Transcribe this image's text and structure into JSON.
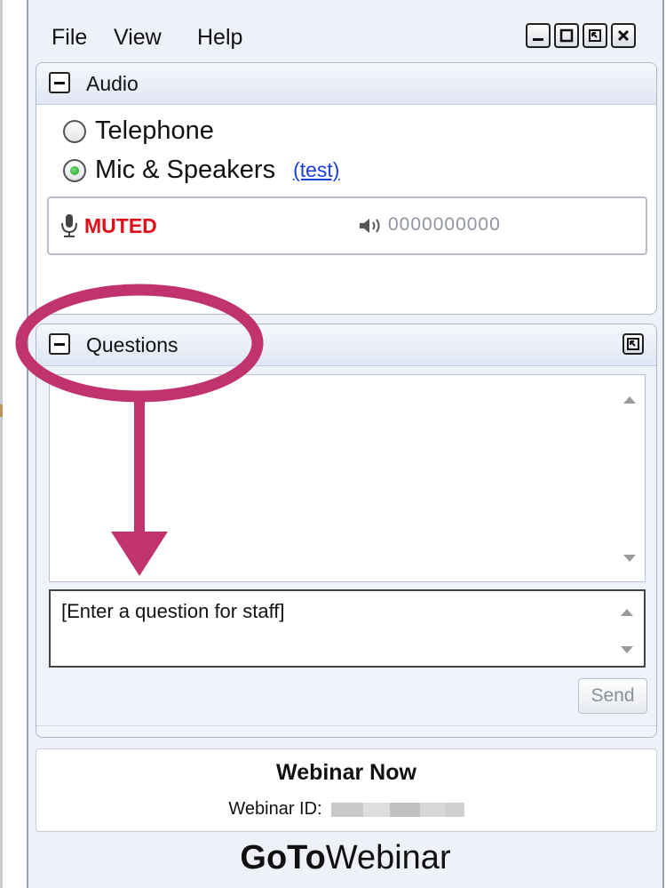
{
  "menu": {
    "items": [
      "File",
      "View",
      "Help"
    ]
  },
  "window_controls": {
    "minimize": "minimize-icon",
    "maximize": "maximize-icon",
    "popout": "popout-icon",
    "close": "close-icon"
  },
  "audio": {
    "title": "Audio",
    "options": [
      {
        "label": "Telephone",
        "checked": false
      },
      {
        "label": "Mic & Speakers",
        "checked": true
      }
    ],
    "test_link": "(test)",
    "mic_status": "MUTED",
    "speaker_level": "0000000000"
  },
  "questions": {
    "title": "Questions",
    "input_placeholder": "[Enter a question for staff]",
    "send_label": "Send"
  },
  "webinar": {
    "title": "Webinar Now",
    "id_label": "Webinar ID:"
  },
  "brand": {
    "bold": "GoTo",
    "regular": "Webinar"
  },
  "colors": {
    "muted_red": "#e0101a",
    "link_blue": "#1a3fd8",
    "annotation_magenta": "#c0336f",
    "panel_bg": "#eef1f8"
  }
}
